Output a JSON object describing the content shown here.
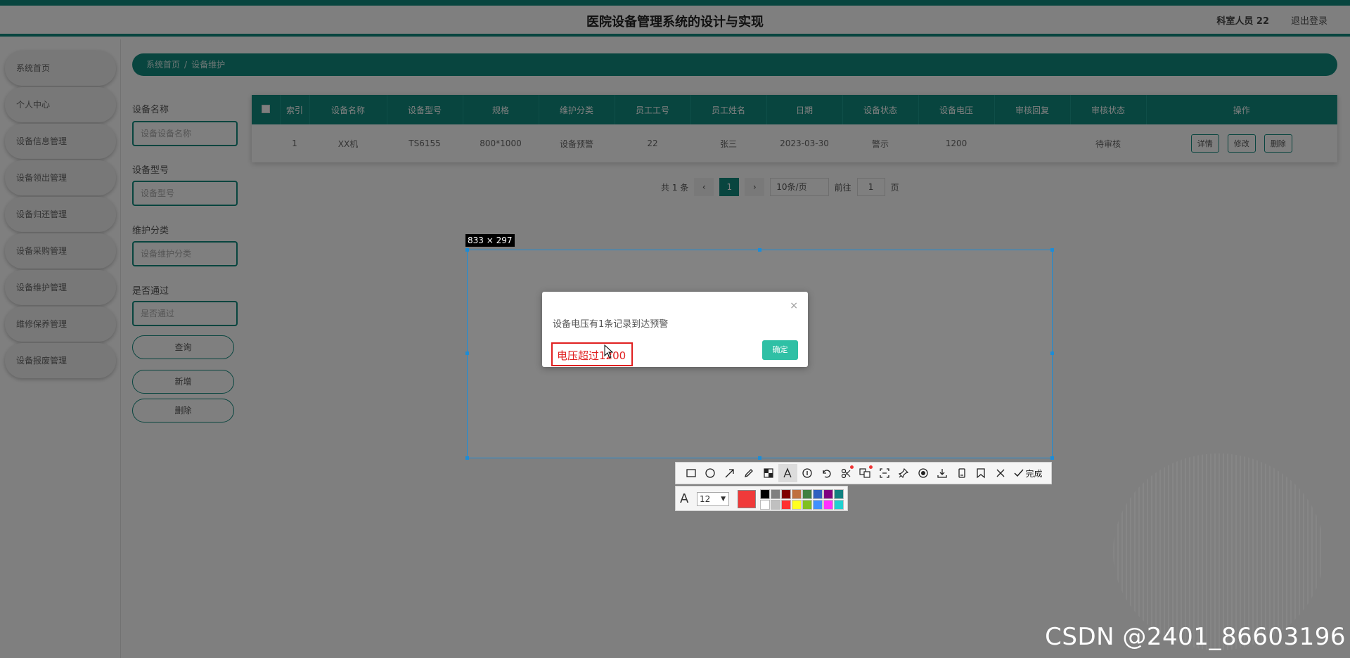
{
  "header": {
    "title": "医院设备管理系统的设计与实现",
    "user": "科室人员 22",
    "logout": "退出登录"
  },
  "sidebar": {
    "items": [
      {
        "label": "系统首页"
      },
      {
        "label": "个人中心"
      },
      {
        "label": "设备信息管理"
      },
      {
        "label": "设备领出管理"
      },
      {
        "label": "设备归还管理"
      },
      {
        "label": "设备采购管理"
      },
      {
        "label": "设备维护管理"
      },
      {
        "label": "维修保养管理"
      },
      {
        "label": "设备报废管理"
      }
    ]
  },
  "breadcrumb": {
    "home": "系统首页",
    "separator": "/",
    "current": "设备维护"
  },
  "filters": {
    "name_label": "设备名称",
    "name_placeholder": "设备设备名称",
    "model_label": "设备型号",
    "model_placeholder": "设备型号",
    "category_label": "维护分类",
    "category_placeholder": "设备维护分类",
    "approved_label": "是否通过",
    "approved_placeholder": "是否通过",
    "search_button": "查询",
    "add_button": "新增",
    "delete_button": "删除"
  },
  "table": {
    "headers": [
      "索引",
      "设备名称",
      "设备型号",
      "规格",
      "维护分类",
      "员工工号",
      "员工姓名",
      "日期",
      "设备状态",
      "设备电压",
      "审核回复",
      "审核状态",
      "操作"
    ],
    "rows": [
      {
        "index": "1",
        "name": "XX机",
        "model": "TS6155",
        "spec": "800*1000",
        "category": "设备预警",
        "emp_id": "22",
        "emp_name": "张三",
        "date": "2023-03-30",
        "status": "警示",
        "voltage": "1200",
        "reply": "",
        "review": "待审核"
      }
    ],
    "actions": [
      "详情",
      "修改",
      "删除"
    ]
  },
  "pagination": {
    "total": "共 1 条",
    "current_page": "1",
    "page_size": "10条/页",
    "goto_label": "前往",
    "goto_value": "1",
    "page_unit": "页"
  },
  "capture": {
    "size_label": "833 × 297"
  },
  "dialog": {
    "message": "设备电压有1条记录到达预警",
    "ok": "确定",
    "close": "×",
    "annotation": "电压超过1200"
  },
  "toolbar": {
    "tools": [
      "rectangle-icon",
      "ellipse-icon",
      "arrow-icon",
      "pen-icon",
      "mosaic-icon",
      "text-icon",
      "number-icon",
      "undo-icon",
      "ocr-icon",
      "translate-icon",
      "scroll-capture-icon",
      "pin-icon",
      "record-icon",
      "download-icon",
      "copy-icon",
      "bookmark-icon",
      "close-icon"
    ],
    "done_label": "完成",
    "font_size": "12",
    "current_color": "#f03a3a",
    "palette": [
      "#000000",
      "#808080",
      "#800000",
      "#c07040",
      "#408040",
      "#3060c0",
      "#800080",
      "#108080",
      "#ffffff",
      "#c0c0c0",
      "#ff3030",
      "#ffff20",
      "#80c020",
      "#4090ff",
      "#ff30ff",
      "#20d0d0"
    ]
  },
  "watermark": "CSDN @2401_86603196",
  "theme": {
    "primary": "#118a7e",
    "ok_button": "#2fc0a5",
    "annotation": "#e02020",
    "selection": "#1d8cd6"
  }
}
